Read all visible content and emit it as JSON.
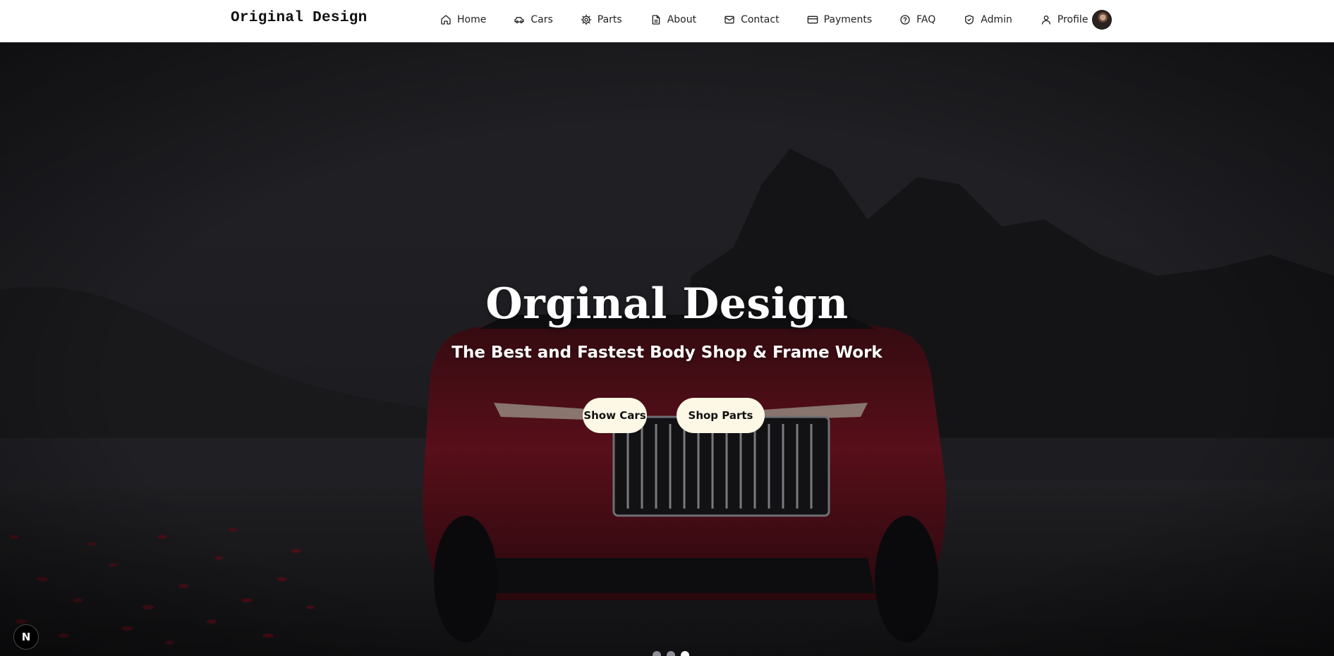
{
  "header": {
    "brand": "Original Design",
    "nav": [
      {
        "label": "Home",
        "icon": "home-icon"
      },
      {
        "label": "Cars",
        "icon": "car-icon"
      },
      {
        "label": "Parts",
        "icon": "gear-icon"
      },
      {
        "label": "About",
        "icon": "document-icon"
      },
      {
        "label": "Contact",
        "icon": "mail-icon"
      },
      {
        "label": "Payments",
        "icon": "credit-card-icon"
      },
      {
        "label": "FAQ",
        "icon": "help-circle-icon"
      },
      {
        "label": "Admin",
        "icon": "shield-icon"
      },
      {
        "label": "Profile",
        "icon": "user-icon"
      }
    ],
    "avatar_icon": "avatar"
  },
  "hero": {
    "title": "Orginal Design",
    "subtitle": "The Best and Fastest Body Shop & Frame Work",
    "buttons": {
      "show_cars": "Show Cars",
      "shop_parts": "Shop Parts"
    },
    "carousel": {
      "slides": 3,
      "active_index": 2
    }
  },
  "dev_badge": {
    "label": "N"
  },
  "colors": {
    "header_bg": "#ffffff",
    "hero_overlay": "#1a1a1e",
    "button_bg": "#fdf8e6",
    "car_red": "#7a1524"
  }
}
